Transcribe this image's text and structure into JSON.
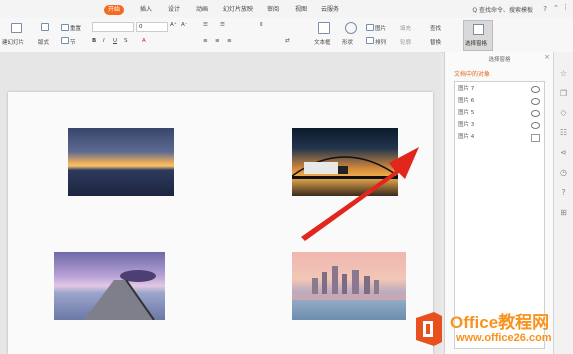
{
  "menu": {
    "tabs": [
      "开始",
      "插入",
      "设计",
      "动画",
      "幻灯片放映",
      "审阅",
      "视图",
      "云服务"
    ],
    "active_tab": "开始",
    "search": "Q 查找命令、搜索模板",
    "help": "?"
  },
  "ribbon": {
    "new_slide": "建幻灯片",
    "layout": "版式",
    "reset": "重置",
    "section": "节",
    "font_size": "0",
    "font_grow": "A⁺",
    "font_shrink": "A⁻",
    "text_box": "文本框",
    "shape": "形状",
    "picture": "图片",
    "arrange": "排列",
    "fill": "填充",
    "outline": "轮廓",
    "find": "查找",
    "replace": "替换",
    "selection_pane": "选择窗格"
  },
  "panel": {
    "title": "选择窗格",
    "subtitle": "文档中的对象",
    "close": "×",
    "objects": [
      {
        "name": "图片 7",
        "visible": true
      },
      {
        "name": "图片 6",
        "visible": true
      },
      {
        "name": "图片 5",
        "visible": true
      },
      {
        "name": "图片 3",
        "visible": true
      },
      {
        "name": "图片 4",
        "visible": false
      }
    ]
  },
  "watermark": {
    "title": "Office教程网",
    "url": "www.office26.com"
  },
  "colors": {
    "accent": "#f36b21",
    "arrow": "#e2261c",
    "watermark": "#f7931e"
  },
  "icons": [
    "star-icon",
    "copy-icon",
    "shape-icon",
    "settings-icon",
    "share-icon",
    "clock-icon",
    "help-icon",
    "grid-icon"
  ]
}
